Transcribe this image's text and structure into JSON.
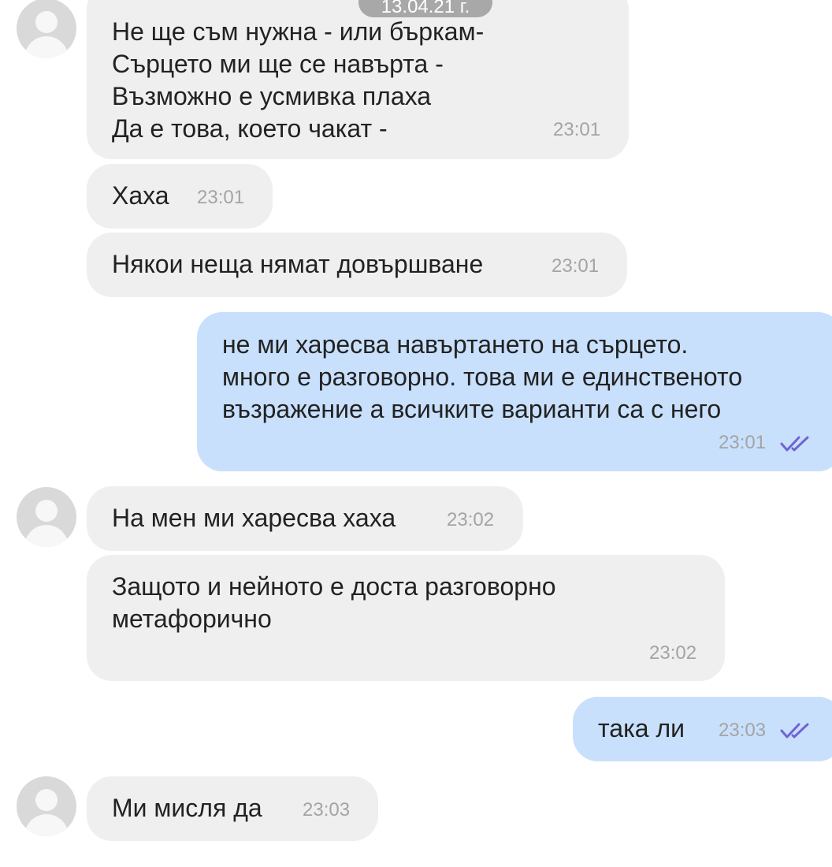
{
  "date_separator": "13.04.21 г.",
  "messages": [
    {
      "from": "them",
      "text": "Не ще съм нужна - или бъркам-\nСърцето ми ще се навърта -\nВъзможно е усмивка плаха\nДа е това, което чакат -",
      "time": "23:01"
    },
    {
      "from": "them",
      "text": "Хаха",
      "time": "23:01"
    },
    {
      "from": "them",
      "text": "Някои неща нямат довършване",
      "time": "23:01"
    },
    {
      "from": "me",
      "text": "не ми харесва навъртането на сърцето.\nмного е разговорно. това ми е единственото\nвъзражение а всичките варианти са с него",
      "time": "23:01",
      "status_icon": "double-check-icon"
    },
    {
      "from": "them",
      "text": "На мен ми харесва хаха",
      "time": "23:02"
    },
    {
      "from": "them",
      "text": "Защото и нейното е доста разговорно\nметафорично",
      "time": "23:02"
    },
    {
      "from": "me",
      "text": "така ли",
      "time": "23:03",
      "status_icon": "double-check-icon"
    },
    {
      "from": "them",
      "text": "Ми мисля да",
      "time": "23:03"
    }
  ],
  "colors": {
    "incoming_bubble": "#efefef",
    "outgoing_bubble": "#c8e0fc",
    "check_mark": "#6f63d6",
    "time_text": "#a4a4a4"
  }
}
